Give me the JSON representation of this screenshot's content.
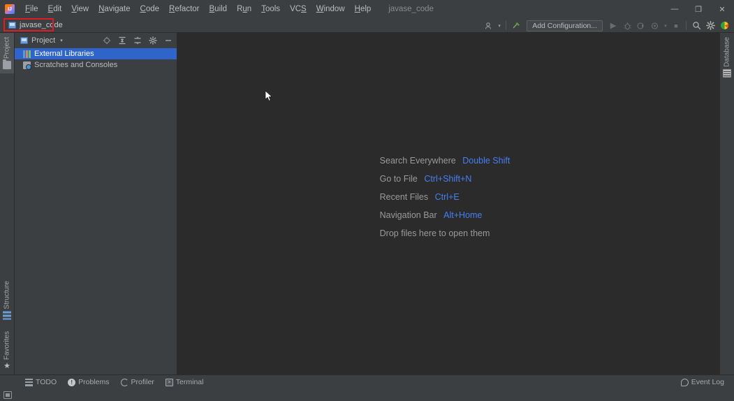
{
  "window": {
    "title": "javase_code",
    "logo_icon": "intellij-idea-logo",
    "controls": {
      "minimize": "—",
      "maximize": "❐",
      "close": "✕"
    }
  },
  "menubar": {
    "items": [
      {
        "label": "File",
        "mnemonic": "F"
      },
      {
        "label": "Edit",
        "mnemonic": "E"
      },
      {
        "label": "View",
        "mnemonic": "V"
      },
      {
        "label": "Navigate",
        "mnemonic": "N"
      },
      {
        "label": "Code",
        "mnemonic": "C"
      },
      {
        "label": "Refactor",
        "mnemonic": "R"
      },
      {
        "label": "Build",
        "mnemonic": "B"
      },
      {
        "label": "Run",
        "mnemonic": "u"
      },
      {
        "label": "Tools",
        "mnemonic": "T"
      },
      {
        "label": "VCS",
        "mnemonic": "S"
      },
      {
        "label": "Window",
        "mnemonic": "W"
      },
      {
        "label": "Help",
        "mnemonic": "H"
      }
    ],
    "project_name": "javase_code"
  },
  "toolbar": {
    "breadcrumb": {
      "icon": "project-module-icon",
      "label": "javase_code",
      "highlight_color": "#e01b24",
      "highlighted": true
    },
    "right_controls": [
      {
        "name": "vcs-updates-icon",
        "glyph": "⚇"
      },
      {
        "name": "vcs-dropdown-caret",
        "glyph": "▾"
      },
      {
        "name": "build-hammer-icon",
        "glyph": "⚒"
      }
    ],
    "add_configuration_label": "Add Configuration...",
    "run_controls": [
      {
        "name": "run-icon",
        "glyph": "▶"
      },
      {
        "name": "debug-icon",
        "glyph": "⚙"
      },
      {
        "name": "run-coverage-icon",
        "glyph": "◔"
      },
      {
        "name": "profile-icon",
        "glyph": "◕"
      },
      {
        "name": "profile-caret-icon",
        "glyph": "▾"
      },
      {
        "name": "stop-icon",
        "glyph": "■"
      }
    ],
    "far_right_controls": [
      {
        "name": "search-everywhere-icon",
        "glyph": "⌕"
      },
      {
        "name": "settings-gear-icon",
        "glyph": "⚙"
      },
      {
        "name": "ide-feature-icon",
        "glyph": "◕"
      }
    ]
  },
  "left_stripe": {
    "top": [
      {
        "name": "sidebar-item-project",
        "label": "Project",
        "icon": "folder-icon",
        "active": true
      }
    ],
    "bottom": [
      {
        "name": "sidebar-item-structure",
        "label": "Structure",
        "icon": "structure-icon",
        "active": false
      },
      {
        "name": "sidebar-item-favorites",
        "label": "Favorites",
        "icon": "star-icon",
        "active": false
      }
    ]
  },
  "right_stripe": {
    "items": [
      {
        "name": "sidebar-item-database",
        "label": "Database",
        "icon": "database-icon"
      }
    ]
  },
  "project_panel": {
    "title": "Project",
    "caret": "▾",
    "header_icons": [
      {
        "name": "select-opened-file-icon",
        "glyph": "⊕"
      },
      {
        "name": "collapse-all-icon",
        "glyph": "⨌"
      },
      {
        "name": "expand-all-icon",
        "glyph": "≡"
      },
      {
        "name": "panel-settings-gear-icon",
        "glyph": "⚙"
      },
      {
        "name": "hide-panel-icon",
        "glyph": "—"
      }
    ],
    "tree": [
      {
        "label": "External Libraries",
        "icon": "external-libraries-icon",
        "selected": true
      },
      {
        "label": "Scratches and Consoles",
        "icon": "scratches-icon",
        "selected": false
      }
    ]
  },
  "editor": {
    "hints": [
      {
        "action": "Search Everywhere",
        "shortcut": "Double Shift"
      },
      {
        "action": "Go to File",
        "shortcut": "Ctrl+Shift+N"
      },
      {
        "action": "Recent Files",
        "shortcut": "Ctrl+E"
      },
      {
        "action": "Navigation Bar",
        "shortcut": "Alt+Home"
      },
      {
        "action": "Drop files here to open them",
        "shortcut": ""
      }
    ],
    "background_color": "#2b2b2b",
    "shortcut_color": "#467ff2"
  },
  "bottom_stripe": {
    "left": [
      {
        "name": "tool-tab-todo",
        "label": "TODO",
        "icon": "todo-icon"
      },
      {
        "name": "tool-tab-problems",
        "label": "Problems",
        "icon": "problems-icon"
      },
      {
        "name": "tool-tab-profiler",
        "label": "Profiler",
        "icon": "profiler-icon"
      },
      {
        "name": "tool-tab-terminal",
        "label": "Terminal",
        "icon": "terminal-icon"
      }
    ],
    "right": {
      "name": "event-log-button",
      "label": "Event Log",
      "icon": "event-log-icon"
    }
  },
  "statusbar": {
    "layout_toggle_icon": "layout-toggle-icon"
  }
}
